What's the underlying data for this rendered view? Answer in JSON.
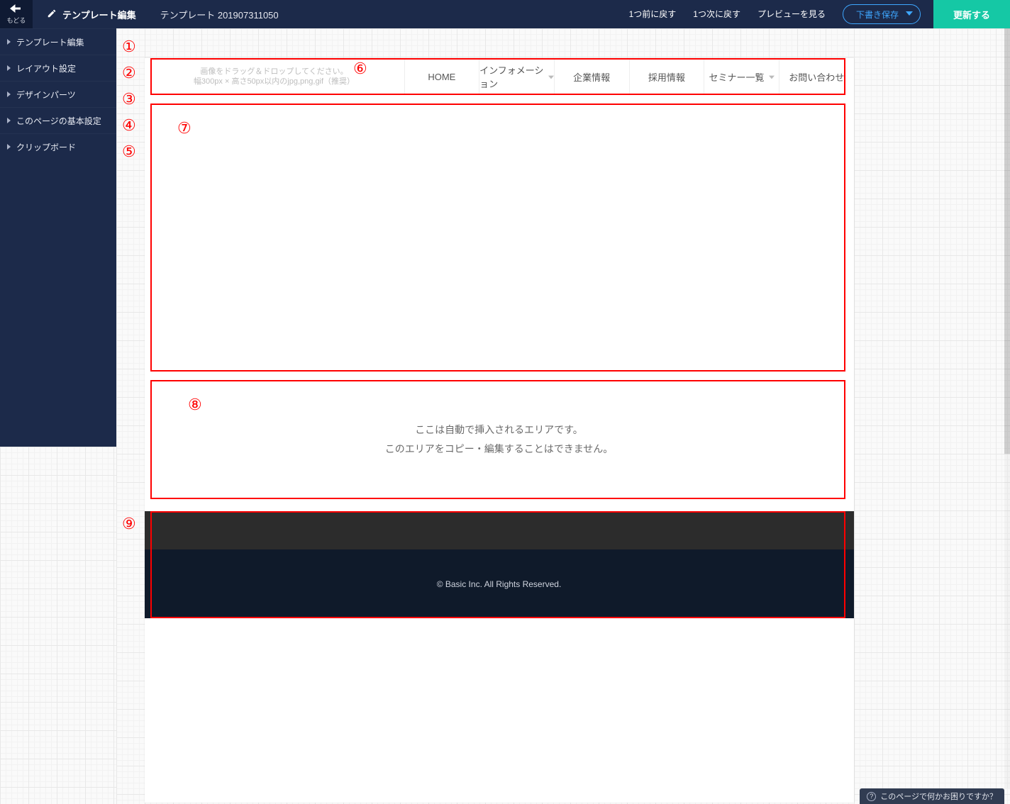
{
  "topbar": {
    "back_small": "もどる",
    "page_title": "テンプレート編集",
    "doc_name": "テンプレート 201907311050",
    "undo": "1つ前に戻す",
    "redo": "1つ次に戻す",
    "preview": "プレビューを見る",
    "draft": "下書き保存",
    "update": "更新する"
  },
  "sidebar": {
    "items": [
      {
        "label": "テンプレート編集"
      },
      {
        "label": "レイアウト設定"
      },
      {
        "label": "デザインパーツ"
      },
      {
        "label": "このページの基本設定"
      },
      {
        "label": "クリップボード"
      }
    ]
  },
  "annotations": {
    "a1": "①",
    "a2": "②",
    "a3": "③",
    "a4": "④",
    "a5": "⑤",
    "a6": "⑥",
    "a7": "⑦",
    "a8": "⑧",
    "a9": "⑨"
  },
  "nav": {
    "logo_drop_line1": "画像をドラッグ＆ドロップしてください。",
    "logo_drop_line2": "幅300px × 高さ50px以内のjpg,png,gif（推奨）",
    "items": [
      {
        "label": "HOME",
        "dropdown": false
      },
      {
        "label": "インフォメーション",
        "dropdown": true
      },
      {
        "label": "企業情報",
        "dropdown": false
      },
      {
        "label": "採用情報",
        "dropdown": false
      },
      {
        "label": "セミナー一覧",
        "dropdown": true
      },
      {
        "label": "お問い合わせ",
        "dropdown": false
      }
    ]
  },
  "auto_area": {
    "line1": "ここは自動で挿入されるエリアです。",
    "line2": "このエリアをコピー・編集することはできません。"
  },
  "footer": {
    "copyright": "© Basic Inc. All Rights Reserved."
  },
  "help_chip": {
    "text": "このページで何かお困りですか？"
  }
}
